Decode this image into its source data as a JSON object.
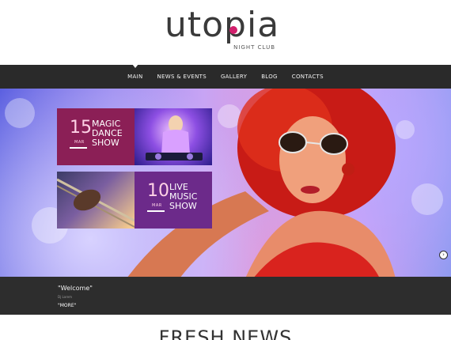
{
  "logo": {
    "wordmark": "utopia",
    "subtitle": "NIGHT CLUB",
    "accent_color": "#d21f6c"
  },
  "nav": {
    "items": [
      {
        "label": "MAIN",
        "active": true
      },
      {
        "label": "NEWS & EVENTS",
        "active": false
      },
      {
        "label": "GALLERY",
        "active": false
      },
      {
        "label": "BLOG",
        "active": false
      },
      {
        "label": "CONTACTS",
        "active": false
      }
    ]
  },
  "promos": [
    {
      "day": "15",
      "month": "MAR",
      "title": "MAGIC DANCE SHOW",
      "color": "#8b1f56"
    },
    {
      "day": "10",
      "month": "MAR",
      "title": "LIVE MUSIC SHOW",
      "color": "#6c2a8a"
    }
  ],
  "slider": {
    "next_icon": "chevron-right-icon",
    "next_glyph": "›"
  },
  "caption": {
    "welcome": "\"Welcome\"",
    "subtitle": "Dj Lorem",
    "more": "\"MORE\""
  },
  "fresh_news": {
    "title": "FRESH NEWS"
  }
}
